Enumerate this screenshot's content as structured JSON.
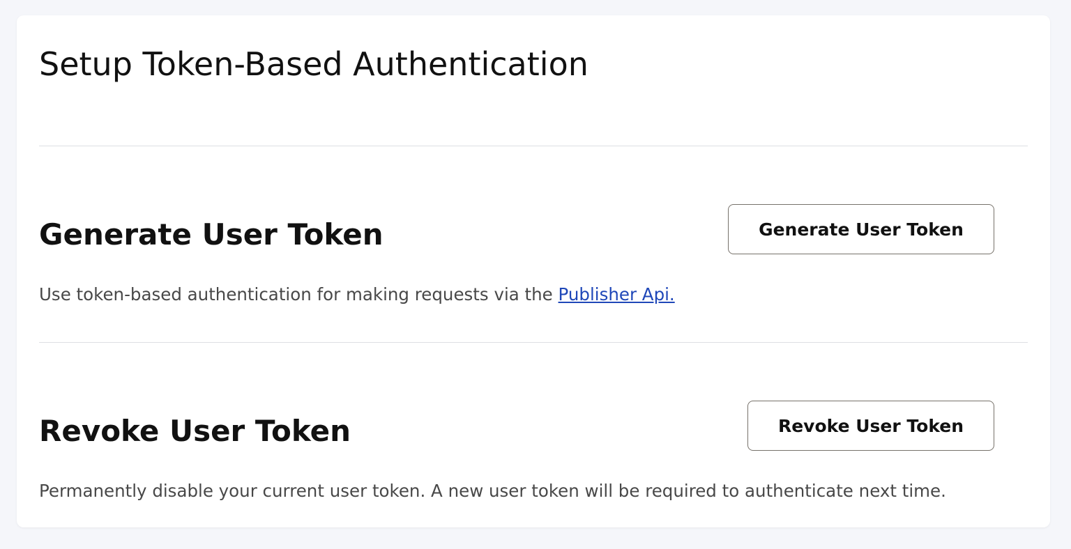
{
  "page": {
    "title": "Setup Token-Based Authentication"
  },
  "generate": {
    "title": "Generate User Token",
    "button_label": "Generate User Token",
    "description": "Use token-based authentication for making requests via the ",
    "link_text": "Publisher Api."
  },
  "revoke": {
    "title": "Revoke User Token",
    "button_label": "Revoke User Token",
    "description": "Permanently disable your current user token. A new user token will be required to authenticate next time."
  },
  "colors": {
    "background": "#f5f6fa",
    "card": "#ffffff",
    "link": "#1f47b8",
    "button_border": "#76716a",
    "divider": "#dddfe3"
  }
}
